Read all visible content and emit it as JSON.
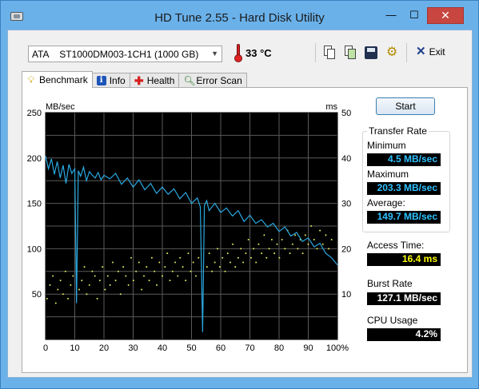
{
  "window": {
    "title": "HD Tune 2.55 - Hard Disk Utility",
    "minimize_label": "—",
    "maximize_label": "☐",
    "close_label": "✕"
  },
  "toolbar": {
    "drive": "ATA    ST1000DM003-1CH1 (1000 GB)",
    "temperature": "33 °C",
    "exit_label": "Exit",
    "tools": [
      "copy-text-icon",
      "copy-screenshot-icon",
      "save-icon",
      "options-icon"
    ]
  },
  "tabs": [
    {
      "label": "Benchmark",
      "icon": "bulb-icon",
      "active": true
    },
    {
      "label": "Info",
      "icon": "info-icon",
      "active": false
    },
    {
      "label": "Health",
      "icon": "health-cross-icon",
      "active": false
    },
    {
      "label": "Error Scan",
      "icon": "magnifier-icon",
      "active": false
    }
  ],
  "benchmark": {
    "start_label": "Start",
    "transfer_rate_title": "Transfer Rate",
    "minimum_label": "Minimum",
    "minimum_value": "4.5 MB/sec",
    "maximum_label": "Maximum",
    "maximum_value": "203.3 MB/sec",
    "average_label": "Average:",
    "average_value": "149.7 MB/sec",
    "access_time_label": "Access Time:",
    "access_time_value": "16.4 ms",
    "burst_rate_label": "Burst Rate",
    "burst_rate_value": "127.1 MB/sec",
    "cpu_usage_label": "CPU Usage",
    "cpu_usage_value": "4.2%"
  },
  "chart_data": {
    "type": "line",
    "y_left_label": "MB/sec",
    "y_right_label": "ms",
    "y_left_ticks": [
      "250",
      "200",
      "150",
      "100",
      "50"
    ],
    "y_right_ticks": [
      "50",
      "40",
      "30",
      "20",
      "10"
    ],
    "x_ticks": [
      "0",
      "10",
      "20",
      "30",
      "40",
      "50",
      "60",
      "70",
      "80",
      "90",
      "100%"
    ],
    "ylim": [
      0,
      250
    ],
    "y2lim": [
      0,
      50
    ],
    "xlim": [
      0,
      100
    ],
    "grid": true,
    "colors": {
      "background": "#000000",
      "grid": "#5a5a5a",
      "transfer": "#2aa8e0",
      "access": "#e8e860"
    },
    "series": [
      {
        "kind": "transfer",
        "x": [
          0,
          1,
          2,
          3,
          4,
          5,
          6,
          7,
          8,
          9,
          10,
          10.6,
          11.2,
          12,
          13,
          14,
          15,
          16,
          17,
          18,
          19,
          20,
          22,
          24,
          26,
          28,
          30,
          32,
          34,
          36,
          38,
          40,
          42,
          44,
          46,
          48,
          50,
          52,
          53,
          53.8,
          54.4,
          55.2,
          56,
          58,
          60,
          62,
          64,
          66,
          68,
          70,
          72,
          74,
          76,
          78,
          80,
          82,
          84,
          86,
          88,
          90,
          92,
          94,
          96,
          98,
          100
        ],
        "y": [
          202,
          188,
          199,
          182,
          196,
          178,
          192,
          172,
          193,
          183,
          188,
          40,
          186,
          180,
          190,
          175,
          185,
          181,
          178,
          184,
          176,
          181,
          177,
          183,
          171,
          178,
          168,
          176,
          165,
          172,
          161,
          168,
          160,
          166,
          155,
          162,
          150,
          156,
          146,
          8,
          148,
          153,
          142,
          150,
          140,
          145,
          136,
          142,
          130,
          137,
          128,
          132,
          124,
          128,
          119,
          124,
          114,
          118,
          108,
          112,
          102,
          106,
          95,
          90,
          82
        ]
      },
      {
        "kind": "access_time",
        "note_dots": "scattered access time samples",
        "x": [
          0.5,
          1.5,
          2.5,
          3.5,
          4.2,
          5.1,
          6,
          6.8,
          7.7,
          8.6,
          9.4,
          11.5,
          12.4,
          13.3,
          14.1,
          15,
          16,
          16.9,
          17.7,
          18.6,
          19.5,
          20.4,
          21.3,
          22.1,
          23,
          24,
          24.9,
          25.7,
          26.6,
          27.5,
          28.4,
          29.3,
          30.1,
          31,
          32,
          32.9,
          33.7,
          34.6,
          35.5,
          36.4,
          37.3,
          38.1,
          39,
          40,
          40.9,
          41.7,
          42.6,
          43.5,
          44.4,
          45.3,
          46.1,
          47,
          48,
          48.9,
          49.7,
          50.6,
          51.5,
          52.4,
          55.3,
          56.1,
          57,
          58,
          58.9,
          59.7,
          60.6,
          61.5,
          62.4,
          63.3,
          64.1,
          65,
          66,
          66.9,
          67.7,
          68.6,
          69.5,
          70.4,
          71.3,
          72.1,
          73,
          74,
          74.9,
          75.7,
          76.6,
          77.5,
          78.4,
          79.3,
          80.1,
          81,
          82,
          82.9,
          83.7,
          84.6,
          85.5,
          86.4,
          87.3,
          88.1,
          89,
          90,
          91,
          92,
          93,
          94,
          95,
          96,
          97,
          98
        ],
        "y": [
          9,
          12,
          14,
          8,
          11,
          13,
          10,
          15,
          9,
          12,
          14,
          11,
          13,
          16,
          10,
          12,
          15,
          14,
          9,
          13,
          16,
          11,
          14,
          12,
          17,
          13,
          15,
          10,
          16,
          14,
          12,
          18,
          13,
          15,
          17,
          11,
          14,
          16,
          13,
          18,
          15,
          12,
          17,
          14,
          16,
          19,
          13,
          15,
          17,
          14,
          18,
          16,
          13,
          19,
          15,
          17,
          14,
          18,
          16,
          19,
          15,
          17,
          20,
          16,
          18,
          15,
          19,
          17,
          21,
          16,
          18,
          20,
          17,
          19,
          22,
          18,
          20,
          17,
          21,
          19,
          23,
          18,
          20,
          22,
          19,
          21,
          18,
          22,
          20,
          24,
          19,
          21,
          23,
          20,
          22,
          19,
          23,
          21,
          25,
          22,
          20,
          24,
          21,
          23,
          20,
          22
        ]
      }
    ]
  }
}
